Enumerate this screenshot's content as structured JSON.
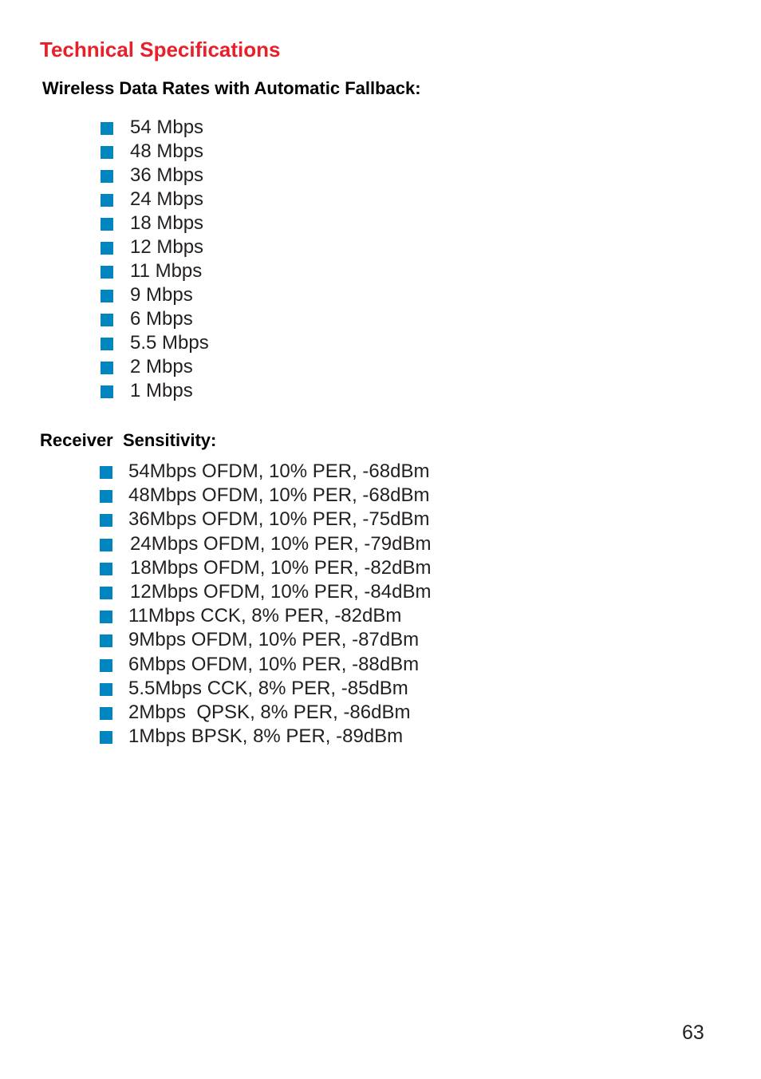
{
  "page": {
    "title": "Technical Specifications",
    "page_number": "63"
  },
  "colors": {
    "title": "#e8202a",
    "bullet": "#0085c0",
    "text": "#231f20"
  },
  "data_rates": {
    "heading": "Wireless Data Rates with Automatic Fallback:",
    "bullet_icon": "square-bullet-icon",
    "items": [
      "54 Mbps",
      "48 Mbps",
      "36 Mbps",
      "24 Mbps",
      "18 Mbps",
      "12 Mbps",
      "11 Mbps",
      "9 Mbps",
      "6 Mbps",
      "5.5 Mbps",
      "2 Mbps",
      "1 Mbps"
    ]
  },
  "receiver_sensitivity": {
    "heading": "Receiver  Sensitivity:",
    "bullet_icon": "square-bullet-icon",
    "items": [
      "54Mbps OFDM, 10% PER, -68dBm",
      "48Mbps OFDM, 10% PER, -68dBm",
      "36Mbps OFDM, 10% PER, -75dBm",
      "24Mbps OFDM, 10% PER, -79dBm",
      "18Mbps OFDM, 10% PER, -82dBm",
      "12Mbps OFDM, 10% PER, -84dBm",
      "11Mbps CCK, 8% PER, -82dBm",
      "9Mbps OFDM, 10% PER, -87dBm",
      "6Mbps OFDM, 10% PER, -88dBm",
      "5.5Mbps CCK, 8% PER, -85dBm",
      "2Mbps  QPSK, 8% PER, -86dBm",
      "1Mbps BPSK, 8% PER, -89dBm"
    ]
  }
}
